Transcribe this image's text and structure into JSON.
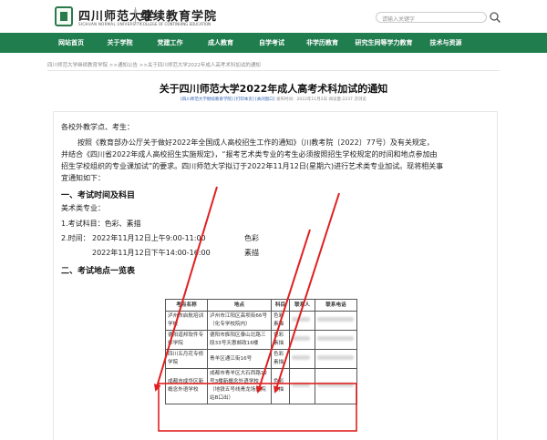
{
  "header": {
    "logo_cn": "四川师范大学",
    "logo_en": "SICHUAN NORMAL UNIVERSITY",
    "college_cn": "继续教育学院",
    "college_en": "COLLEGE OF CONTINUING EDUCATION",
    "search_placeholder": "请输入关键字"
  },
  "nav": {
    "items": [
      {
        "label": "网站首页",
        "w": 52
      },
      {
        "label": "关于学院",
        "w": 55
      },
      {
        "label": "党建工作",
        "w": 55
      },
      {
        "label": "成人教育",
        "w": 56
      },
      {
        "label": "自学考试",
        "w": 56
      },
      {
        "label": "非学历教育",
        "w": 55
      },
      {
        "label": "研究生同等学力教育",
        "w": 80
      },
      {
        "label": "技术与资源",
        "w": 56
      }
    ]
  },
  "breadcrumb": "四川师范大学继续教育学院   >>通知公告   >>关于四川师范大学2022年成人高考术科加试的通知",
  "article": {
    "title": "关于四川师范大学2022年成人高考术科加试的通知",
    "meta_source": "[四川师范大学继续教育学院]",
    "meta_print": "[打印本页]",
    "meta_close": "[关闭窗口]",
    "meta_info": "发布时间：2022年11月2日  阅读量:2237 次浏览",
    "greeting": "各校外教学点、考生：",
    "body_lines": [
      "按照《教育部办公厅关于做好2022年全国成人高校招生工作的通知》（川教考院〔2022〕77号）及有关规定，",
      "并结合《四川省2022年成人高校招生实施规定》，“报考艺术类专业的考生必须按照招生学校规定的时间和地点参加由",
      "招生学校组织的专业课加试”的要求。四川师范大学拟订于2022年11月12日(星期六)进行艺术类专业加试。现将相关事",
      "宜通知如下："
    ],
    "section1": "一、考试时间及科目",
    "major": "美术类专业：",
    "subjects": "1.考试科目：色彩、素描",
    "time_label": "2.时间：",
    "time1": "2022年11月12日上午9:00-11:00",
    "subject1": "色彩",
    "time2": "2022年11月12日下午14:00-16:00",
    "subject2": "素描",
    "section2": "二、考试地点一览表"
  },
  "table": {
    "headers": [
      "考点名称",
      "地点",
      "科目",
      "联系人",
      "联系电话"
    ],
    "rows": [
      {
        "name": "泸州市启航培训学校",
        "address": "泸州市江阳区高坝街66号（化专学校院内）",
        "subject": "色彩素描"
      },
      {
        "name": "德阳道邦软件专修学院",
        "address": "德阳市旌阳区泰山北路三段33号天惠邮政16楼",
        "subject": "色彩素描"
      },
      {
        "name": "四川五月花专修学院",
        "address": "青羊区通江街16号",
        "subject": "色彩素描"
      },
      {
        "name": "成都市成华区新概念外语学校",
        "address": "成都市青羊区大石西路12号3楼新概念外语学校（地铁五号线青龙场医院站B口出）",
        "subject": "色彩素描"
      }
    ]
  },
  "annotation": {
    "color": "#e02020"
  }
}
